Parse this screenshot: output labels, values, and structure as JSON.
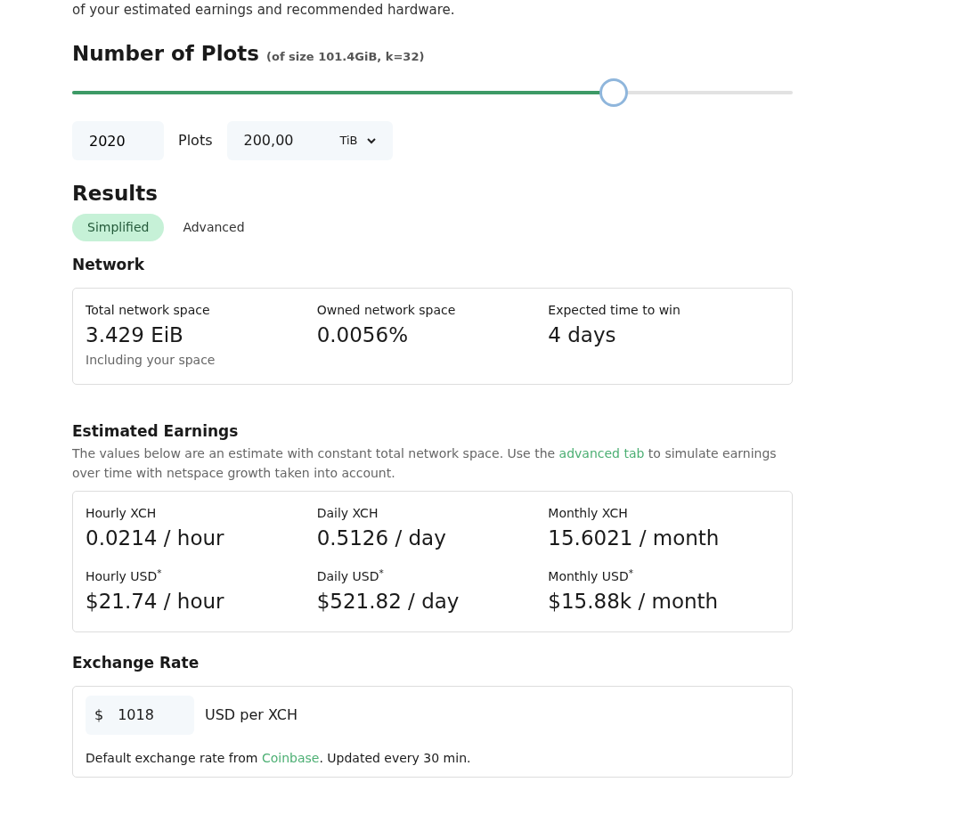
{
  "intro_text": "of your estimated earnings and recommended hardware.",
  "plots": {
    "title": "Number of Plots",
    "subtitle": "(of size 101.4GiB, k=32)",
    "level": 0.751,
    "count": "2020",
    "count_unit": "Plots",
    "size": "200,00",
    "size_unit": "TiB"
  },
  "results": {
    "title": "Results",
    "tabs": [
      {
        "label": "Simplified",
        "selected": true
      },
      {
        "label": "Advanced",
        "selected": false
      }
    ]
  },
  "network": {
    "title": "Network",
    "stats": [
      {
        "label": "Total network space",
        "value": "3.429 EiB",
        "note": "Including your space"
      },
      {
        "label": "Owned network space",
        "value": "0.0056%"
      },
      {
        "label": "Expected time to win",
        "value": "4 days"
      }
    ]
  },
  "earnings": {
    "title": "Estimated Earnings",
    "description": {
      "before": "The values below are an estimate with constant total network space. Use the ",
      "link": "advanced tab",
      "after": " to simulate earnings over time with netspace growth taken into account."
    },
    "stats": [
      {
        "label": "Hourly XCH",
        "value": "0.0214 / hour"
      },
      {
        "label": "Daily XCH",
        "value": "0.5126 / day"
      },
      {
        "label": "Monthly XCH",
        "value": "15.6021 / month"
      },
      {
        "label": "Hourly USD$^{*}$",
        "value": "$21.74 / hour"
      },
      {
        "label": "Daily USD$^{*}$",
        "value": "$521.82 / day"
      },
      {
        "label": "Monthly USD$^{*}$",
        "value": "$15.88k / month"
      }
    ]
  },
  "exchange": {
    "title": "Exchange Rate",
    "currency_symbol": "$",
    "rate": "1018",
    "unit": "USD per XCH",
    "note": {
      "before": "Default exchange rate from ",
      "link": "Coinbase",
      "after": ". Updated every 30 min."
    }
  }
}
